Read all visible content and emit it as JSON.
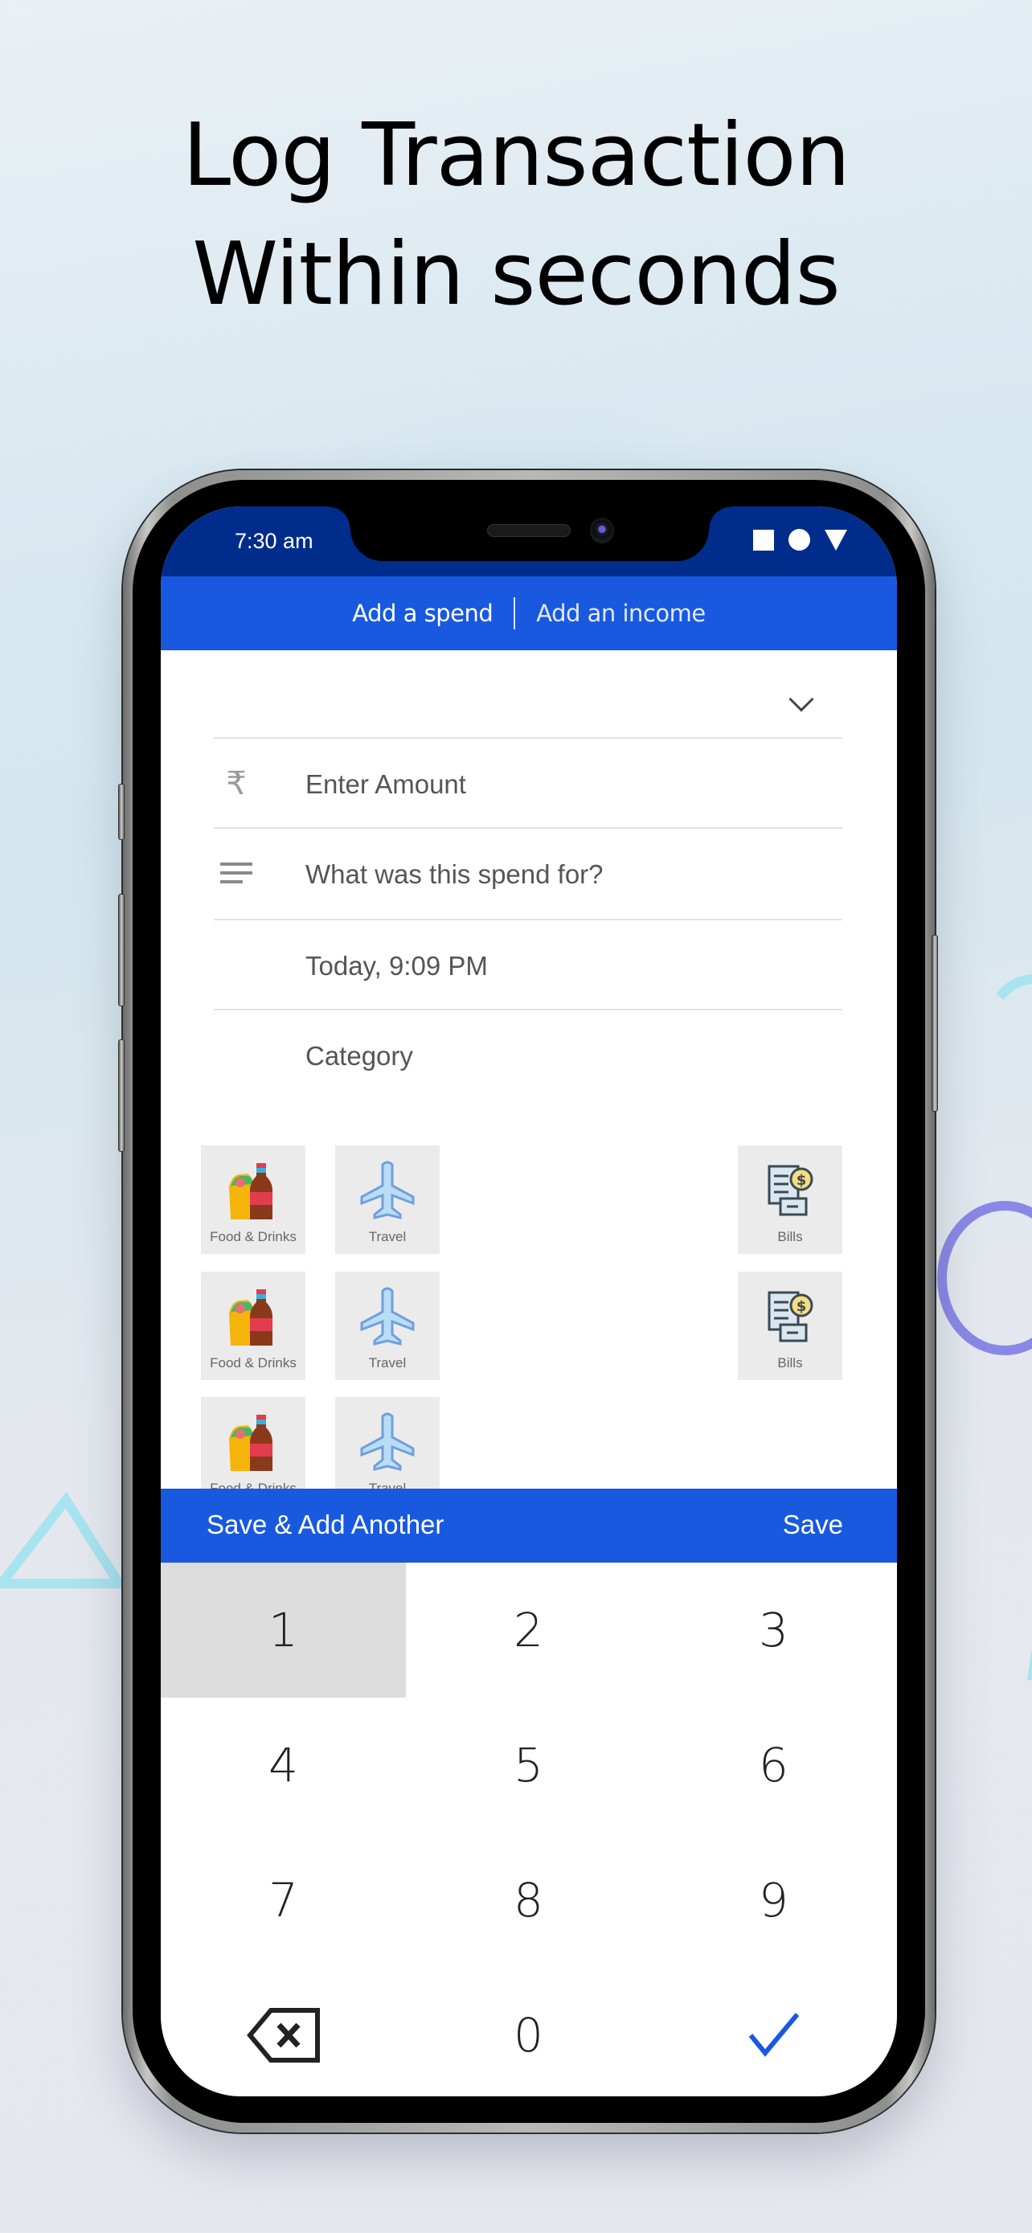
{
  "headline": {
    "line1": "Log Transaction",
    "line2": "Within seconds"
  },
  "status_bar": {
    "time": "7:30 am",
    "icons": [
      "square-icon",
      "circle-icon",
      "triangle-icon"
    ]
  },
  "tabs": [
    {
      "label": "Add a spend",
      "active": true
    },
    {
      "label": "Add an income",
      "active": false
    }
  ],
  "form": {
    "account_dropdown": {
      "value": "",
      "icon": "chevron-down-icon"
    },
    "amount": {
      "placeholder": "Enter Amount",
      "icon": "rupee-icon"
    },
    "description": {
      "placeholder": "What was this spend for?",
      "icon": "notes-icon"
    },
    "date": {
      "value": "Today, 9:09 PM"
    },
    "category": {
      "label": "Category"
    }
  },
  "categories": [
    {
      "label": "Food & Drinks",
      "icon": "food-drinks-icon"
    },
    {
      "label": "Travel",
      "icon": "airplane-icon"
    },
    {
      "label": "Bills",
      "icon": "bills-icon"
    },
    {
      "label": "Food & Drinks",
      "icon": "food-drinks-icon"
    },
    {
      "label": "Travel",
      "icon": "airplane-icon"
    },
    {
      "label": "Bills",
      "icon": "bills-icon"
    },
    {
      "label": "Food & Drinks",
      "icon": "food-drinks-icon"
    },
    {
      "label": "Travel",
      "icon": "airplane-icon"
    }
  ],
  "actions": {
    "save_add_another": "Save & Add Another",
    "save": "Save"
  },
  "keypad": {
    "keys": [
      "1",
      "2",
      "3",
      "4",
      "5",
      "6",
      "7",
      "8",
      "9",
      "",
      "0",
      ""
    ],
    "pressed_key": "1",
    "backspace_icon": "backspace-icon",
    "confirm_icon": "checkmark-icon"
  },
  "colors": {
    "status_bar": "#002d8b",
    "primary": "#1859e0",
    "confirm_check": "#1859e0",
    "deco_triangle": "#a8e3f0",
    "deco_ring": "#8a88e6"
  }
}
